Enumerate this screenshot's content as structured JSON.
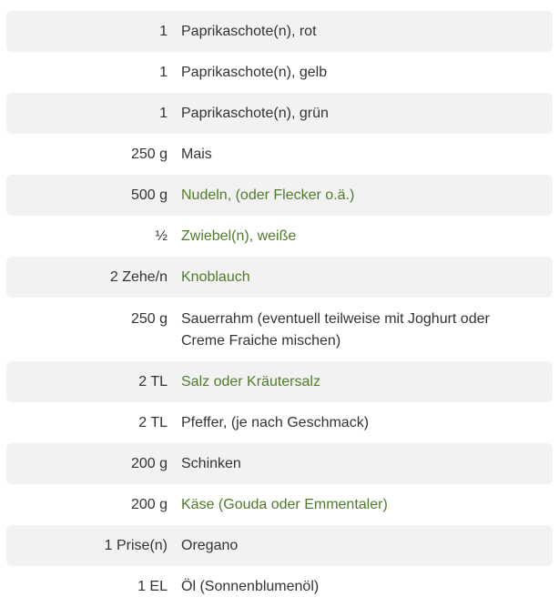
{
  "ingredients": [
    {
      "amount": "1",
      "name": "Paprikaschote(n), rot",
      "link": false
    },
    {
      "amount": "1",
      "name": "Paprikaschote(n), gelb",
      "link": false
    },
    {
      "amount": "1",
      "name": "Paprikaschote(n), grün",
      "link": false
    },
    {
      "amount": "250 g",
      "name": "Mais",
      "link": false
    },
    {
      "amount": "500 g",
      "name": "Nudeln, (oder Flecker o.ä.)",
      "link": true
    },
    {
      "amount": "½",
      "name": "Zwiebel(n), weiße",
      "link": true
    },
    {
      "amount": "2 Zehe/n",
      "name": "Knoblauch",
      "link": true
    },
    {
      "amount": "250 g",
      "name": "Sauerrahm (eventuell teilweise mit Joghurt oder Creme Fraiche mischen)",
      "link": false
    },
    {
      "amount": "2 TL",
      "name": "Salz oder Kräutersalz",
      "link": true
    },
    {
      "amount": "2 TL",
      "name": "Pfeffer, (je nach Geschmack)",
      "link": false
    },
    {
      "amount": "200 g",
      "name": "Schinken",
      "link": false
    },
    {
      "amount": "200 g",
      "name": "Käse (Gouda oder Emmentaler)",
      "link": true
    },
    {
      "amount": "1 Prise(n)",
      "name": "Oregano",
      "link": false
    },
    {
      "amount": "1 EL",
      "name": "Öl (Sonnenblumenöl)",
      "link": false
    }
  ],
  "colors": {
    "text": "#333333",
    "link": "#4f7b2a",
    "stripe": "#f2f2f2"
  }
}
